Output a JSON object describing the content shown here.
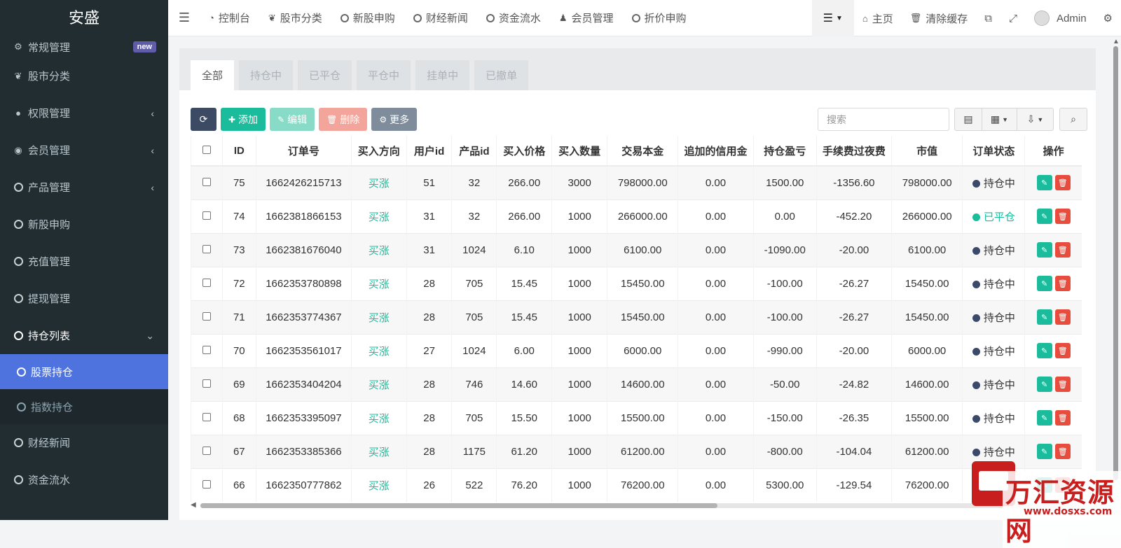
{
  "app": {
    "logo": "安盛"
  },
  "sidebar": {
    "items": [
      {
        "label": "常规管理",
        "icon": "cogs-icon",
        "badge": "new"
      },
      {
        "label": "股市分类",
        "icon": "leaf-icon"
      },
      {
        "label": "权限管理",
        "icon": "group-icon",
        "arrow": "‹"
      },
      {
        "label": "会员管理",
        "icon": "user-circle-icon",
        "arrow": "‹"
      },
      {
        "label": "产品管理",
        "icon": "circle-icon",
        "arrow": "‹"
      },
      {
        "label": "新股申购",
        "icon": "circle-icon"
      },
      {
        "label": "充值管理",
        "icon": "circle-icon"
      },
      {
        "label": "提现管理",
        "icon": "circle-icon"
      },
      {
        "label": "持仓列表",
        "icon": "circle-icon",
        "arrow": "⌄"
      }
    ],
    "sub_items": [
      {
        "label": "股票持仓",
        "active": true
      },
      {
        "label": "指数持仓"
      }
    ],
    "bottom_items": [
      {
        "label": "财经新闻"
      },
      {
        "label": "资金流水"
      }
    ]
  },
  "topnav": {
    "links": [
      {
        "label": "控制台",
        "icon": "dashboard-icon"
      },
      {
        "label": "股市分类",
        "icon": "leaf-icon"
      },
      {
        "label": "新股申购",
        "icon": "circle-icon"
      },
      {
        "label": "财经新闻",
        "icon": "circle-icon"
      },
      {
        "label": "资金流水",
        "icon": "circle-icon"
      },
      {
        "label": "会员管理",
        "icon": "user-icon"
      },
      {
        "label": "折价申购",
        "icon": "circle-icon"
      }
    ],
    "home": "主页",
    "clear_cache": "清除缓存",
    "user": "Admin"
  },
  "tabs": [
    "全部",
    "持仓中",
    "已平仓",
    "平仓中",
    "挂单中",
    "已撤单"
  ],
  "toolbar": {
    "add": "添加",
    "edit": "编辑",
    "delete": "删除",
    "more": "更多"
  },
  "search": {
    "placeholder": "搜索"
  },
  "table": {
    "columns": [
      "ID",
      "订单号",
      "买入方向",
      "用户id",
      "产品id",
      "买入价格",
      "买入数量",
      "交易本金",
      "追加的信用金",
      "持仓盈亏",
      "手续费过夜费",
      "市值",
      "订单状态",
      "操作"
    ],
    "rows": [
      {
        "id": "75",
        "order": "1662426215713",
        "dir": "买涨",
        "uid": "51",
        "pid": "32",
        "price": "266.00",
        "qty": "3000",
        "principal": "798000.00",
        "credit": "0.00",
        "pnl": "1500.00",
        "fee": "-1356.60",
        "value": "798000.00",
        "status": "持仓中",
        "status_type": "hold"
      },
      {
        "id": "74",
        "order": "1662381866153",
        "dir": "买涨",
        "uid": "31",
        "pid": "32",
        "price": "266.00",
        "qty": "1000",
        "principal": "266000.00",
        "credit": "0.00",
        "pnl": "0.00",
        "fee": "-452.20",
        "value": "266000.00",
        "status": "已平仓",
        "status_type": "closed"
      },
      {
        "id": "73",
        "order": "1662381676040",
        "dir": "买涨",
        "uid": "31",
        "pid": "1024",
        "price": "6.10",
        "qty": "1000",
        "principal": "6100.00",
        "credit": "0.00",
        "pnl": "-1090.00",
        "fee": "-20.00",
        "value": "6100.00",
        "status": "持仓中",
        "status_type": "hold"
      },
      {
        "id": "72",
        "order": "1662353780898",
        "dir": "买涨",
        "uid": "28",
        "pid": "705",
        "price": "15.45",
        "qty": "1000",
        "principal": "15450.00",
        "credit": "0.00",
        "pnl": "-100.00",
        "fee": "-26.27",
        "value": "15450.00",
        "status": "持仓中",
        "status_type": "hold"
      },
      {
        "id": "71",
        "order": "1662353774367",
        "dir": "买涨",
        "uid": "28",
        "pid": "705",
        "price": "15.45",
        "qty": "1000",
        "principal": "15450.00",
        "credit": "0.00",
        "pnl": "-100.00",
        "fee": "-26.27",
        "value": "15450.00",
        "status": "持仓中",
        "status_type": "hold"
      },
      {
        "id": "70",
        "order": "1662353561017",
        "dir": "买涨",
        "uid": "27",
        "pid": "1024",
        "price": "6.00",
        "qty": "1000",
        "principal": "6000.00",
        "credit": "0.00",
        "pnl": "-990.00",
        "fee": "-20.00",
        "value": "6000.00",
        "status": "持仓中",
        "status_type": "hold"
      },
      {
        "id": "69",
        "order": "1662353404204",
        "dir": "买涨",
        "uid": "28",
        "pid": "746",
        "price": "14.60",
        "qty": "1000",
        "principal": "14600.00",
        "credit": "0.00",
        "pnl": "-50.00",
        "fee": "-24.82",
        "value": "14600.00",
        "status": "持仓中",
        "status_type": "hold"
      },
      {
        "id": "68",
        "order": "1662353395097",
        "dir": "买涨",
        "uid": "28",
        "pid": "705",
        "price": "15.50",
        "qty": "1000",
        "principal": "15500.00",
        "credit": "0.00",
        "pnl": "-150.00",
        "fee": "-26.35",
        "value": "15500.00",
        "status": "持仓中",
        "status_type": "hold"
      },
      {
        "id": "67",
        "order": "1662353385366",
        "dir": "买涨",
        "uid": "28",
        "pid": "1175",
        "price": "61.20",
        "qty": "1000",
        "principal": "61200.00",
        "credit": "0.00",
        "pnl": "-800.00",
        "fee": "-104.04",
        "value": "61200.00",
        "status": "持仓中",
        "status_type": "hold"
      },
      {
        "id": "66",
        "order": "1662350777862",
        "dir": "买涨",
        "uid": "26",
        "pid": "522",
        "price": "76.20",
        "qty": "1000",
        "principal": "76200.00",
        "credit": "0.00",
        "pnl": "5300.00",
        "fee": "-129.54",
        "value": "76200.00",
        "status": "持仓中",
        "status_type": "hold"
      }
    ]
  },
  "watermark": {
    "text": "万汇资源网",
    "url": "www.dosxs.com"
  },
  "colors": {
    "sidebar_bg": "#222d32",
    "active": "#4e73df",
    "accent": "#1abc9c",
    "danger": "#e74c3c",
    "hold_dot": "#3c4a6a"
  }
}
